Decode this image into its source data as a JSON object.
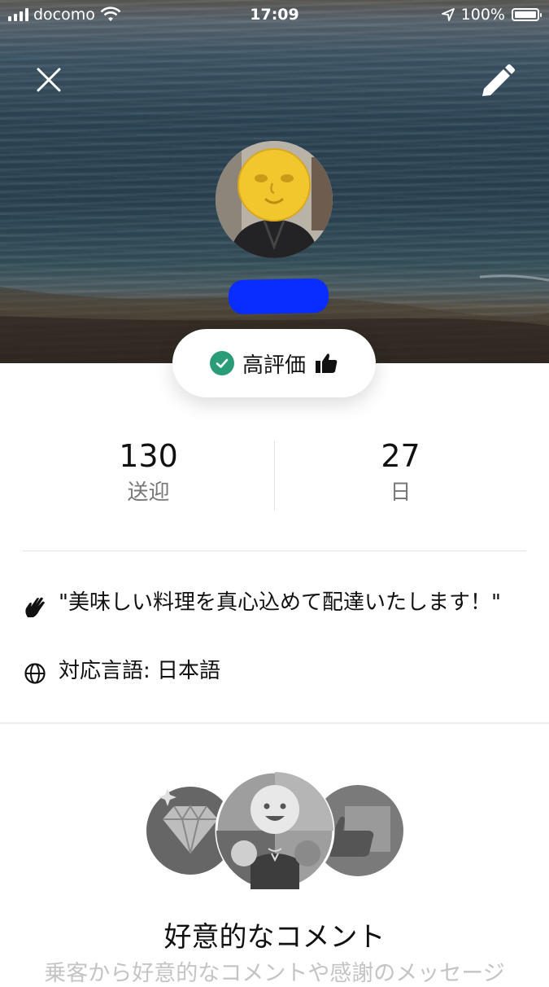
{
  "status_bar": {
    "carrier": "docomo",
    "time": "17:09",
    "battery": "100%"
  },
  "header": {
    "close_icon": "close-icon",
    "edit_icon": "pencil-icon"
  },
  "profile": {
    "rating_label": "高評価"
  },
  "stats": [
    {
      "value": "130",
      "label": "送迎"
    },
    {
      "value": "27",
      "label": "日"
    }
  ],
  "about": {
    "quote": "\"美味しい料理を真心込めて配達いたします！\"",
    "language": "対応言語: 日本語"
  },
  "feature": {
    "title": "好意的なコメント",
    "subtitle": "乗客から好意的なコメントや感謝のメッセージ"
  },
  "colors": {
    "accent_green": "#2a9d78",
    "redaction_blue": "#0a2dff"
  }
}
